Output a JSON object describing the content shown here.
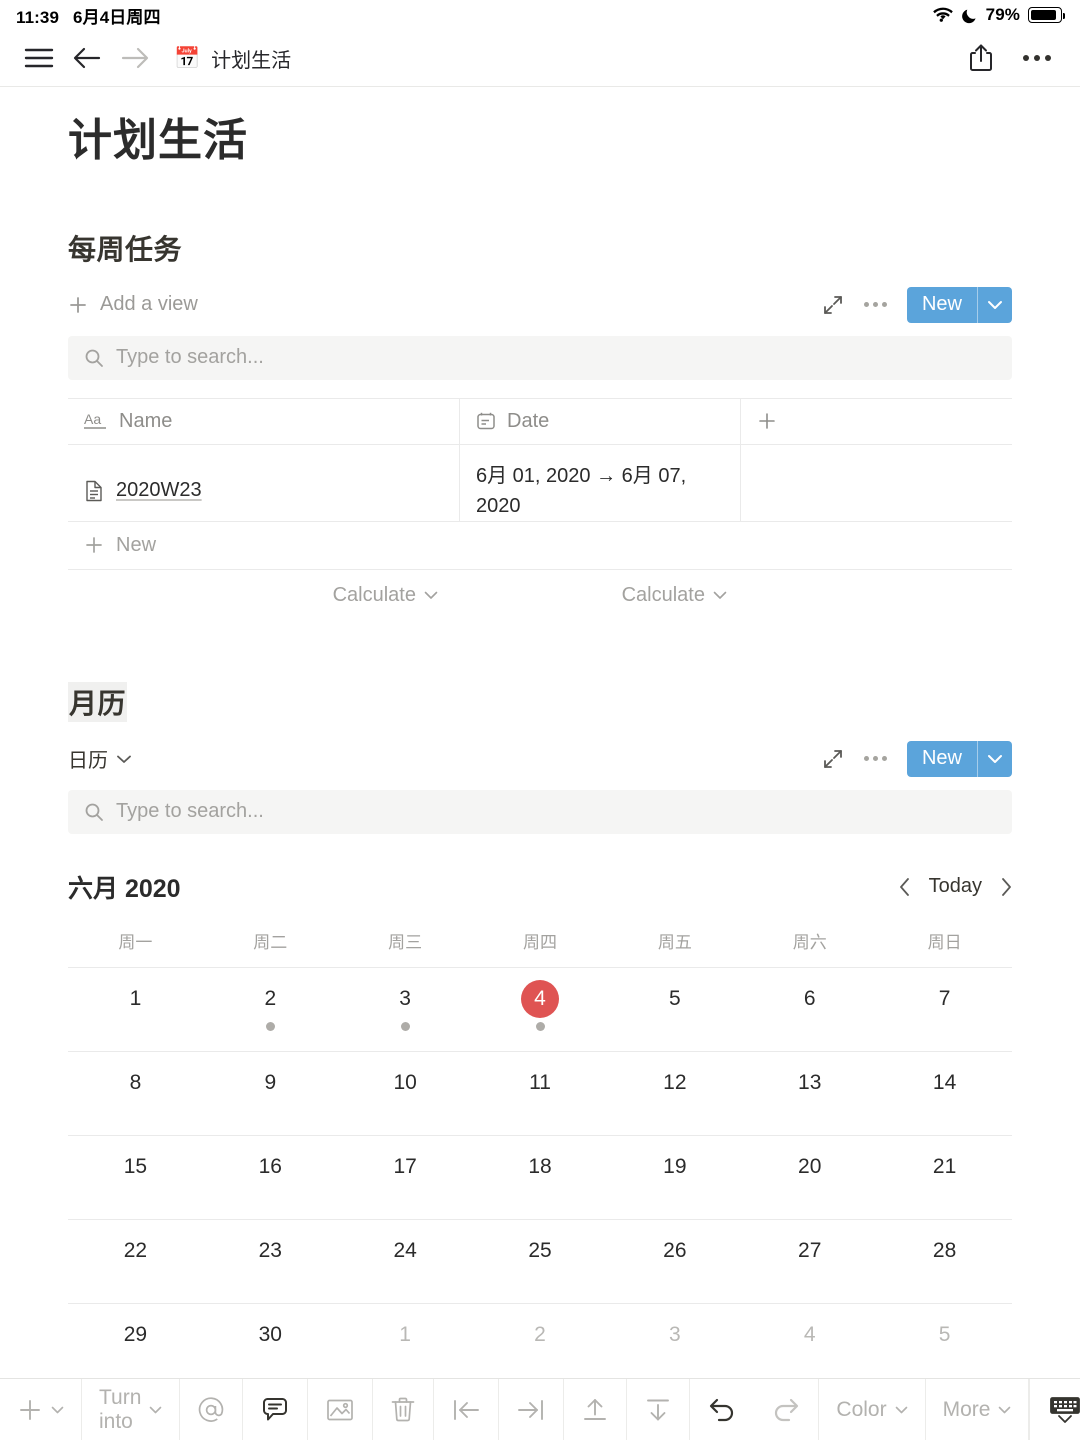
{
  "status_bar": {
    "time": "11:39",
    "date": "6月4日周四",
    "wifi_icon": "wifi-icon",
    "moon_icon": "moon-icon",
    "battery_percent": "79%",
    "battery_icon": "battery-icon"
  },
  "nav_bar": {
    "menu_icon": "hamburger-menu-icon",
    "back_icon": "arrow-left-icon",
    "forward_icon": "arrow-right-icon",
    "breadcrumb_emoji": "📅",
    "breadcrumb_title": "计划生活",
    "share_icon": "share-icon",
    "more_icon": "more-horizontal-icon"
  },
  "page": {
    "title": "计划生活"
  },
  "weekly_tasks": {
    "heading": "每周任务",
    "add_view_label": "Add a view",
    "expand_icon": "expand-icon",
    "more_icon": "more-horizontal-icon",
    "new_button_label": "New",
    "new_button_color": "#5ba4db",
    "search_placeholder": "Type to search...",
    "columns": [
      {
        "label": "Name",
        "icon": "text-type-icon"
      },
      {
        "label": "Date",
        "icon": "calendar-type-icon"
      }
    ],
    "add_column_icon": "plus-icon",
    "rows": [
      {
        "page_icon": "page-icon",
        "name": "2020W23",
        "date": "6月 01, 2020 → 6月 07, 2020"
      }
    ],
    "new_row_label": "New",
    "calculate_label": "Calculate"
  },
  "monthly_calendar": {
    "heading": "月历",
    "view_name": "日历",
    "expand_icon": "expand-icon",
    "more_icon": "more-horizontal-icon",
    "new_button_label": "New",
    "search_placeholder": "Type to search...",
    "month_title": "六月 2020",
    "prev_icon": "chevron-left-icon",
    "today_label": "Today",
    "next_icon": "chevron-right-icon",
    "weekdays": [
      "周一",
      "周二",
      "周三",
      "周四",
      "周五",
      "周六",
      "周日"
    ],
    "today_highlight_color": "#df5453",
    "weeks": [
      [
        {
          "day": "1",
          "muted": false,
          "today": false,
          "dot": false
        },
        {
          "day": "2",
          "muted": false,
          "today": false,
          "dot": true
        },
        {
          "day": "3",
          "muted": false,
          "today": false,
          "dot": true
        },
        {
          "day": "4",
          "muted": false,
          "today": true,
          "dot": true
        },
        {
          "day": "5",
          "muted": false,
          "today": false,
          "dot": false
        },
        {
          "day": "6",
          "muted": false,
          "today": false,
          "dot": false
        },
        {
          "day": "7",
          "muted": false,
          "today": false,
          "dot": false
        }
      ],
      [
        {
          "day": "8",
          "muted": false,
          "today": false,
          "dot": false
        },
        {
          "day": "9",
          "muted": false,
          "today": false,
          "dot": false
        },
        {
          "day": "10",
          "muted": false,
          "today": false,
          "dot": false
        },
        {
          "day": "11",
          "muted": false,
          "today": false,
          "dot": false
        },
        {
          "day": "12",
          "muted": false,
          "today": false,
          "dot": false
        },
        {
          "day": "13",
          "muted": false,
          "today": false,
          "dot": false
        },
        {
          "day": "14",
          "muted": false,
          "today": false,
          "dot": false
        }
      ],
      [
        {
          "day": "15",
          "muted": false,
          "today": false,
          "dot": false
        },
        {
          "day": "16",
          "muted": false,
          "today": false,
          "dot": false
        },
        {
          "day": "17",
          "muted": false,
          "today": false,
          "dot": false
        },
        {
          "day": "18",
          "muted": false,
          "today": false,
          "dot": false
        },
        {
          "day": "19",
          "muted": false,
          "today": false,
          "dot": false
        },
        {
          "day": "20",
          "muted": false,
          "today": false,
          "dot": false
        },
        {
          "day": "21",
          "muted": false,
          "today": false,
          "dot": false
        }
      ],
      [
        {
          "day": "22",
          "muted": false,
          "today": false,
          "dot": false
        },
        {
          "day": "23",
          "muted": false,
          "today": false,
          "dot": false
        },
        {
          "day": "24",
          "muted": false,
          "today": false,
          "dot": false
        },
        {
          "day": "25",
          "muted": false,
          "today": false,
          "dot": false
        },
        {
          "day": "26",
          "muted": false,
          "today": false,
          "dot": false
        },
        {
          "day": "27",
          "muted": false,
          "today": false,
          "dot": false
        },
        {
          "day": "28",
          "muted": false,
          "today": false,
          "dot": false
        }
      ],
      [
        {
          "day": "29",
          "muted": false,
          "today": false,
          "dot": false
        },
        {
          "day": "30",
          "muted": false,
          "today": false,
          "dot": false
        },
        {
          "day": "1",
          "muted": true,
          "today": false,
          "dot": false
        },
        {
          "day": "2",
          "muted": true,
          "today": false,
          "dot": false
        },
        {
          "day": "3",
          "muted": true,
          "today": false,
          "dot": false
        },
        {
          "day": "4",
          "muted": true,
          "today": false,
          "dot": false
        },
        {
          "day": "5",
          "muted": true,
          "today": false,
          "dot": false
        }
      ]
    ]
  },
  "bottom_toolbar": {
    "add_label": "",
    "add_icon": "plus-icon",
    "turn_into_label": "Turn into",
    "mention_icon": "mention-at-icon",
    "comment_icon": "comment-icon",
    "image_icon": "image-icon",
    "delete_icon": "trash-icon",
    "outdent_icon": "outdent-icon",
    "indent_icon": "indent-icon",
    "move_up_icon": "move-up-icon",
    "move_down_icon": "move-down-icon",
    "undo_icon": "undo-icon",
    "redo_icon": "redo-icon",
    "color_label": "Color",
    "more_label": "More",
    "keyboard_icon": "keyboard-dismiss-icon"
  }
}
